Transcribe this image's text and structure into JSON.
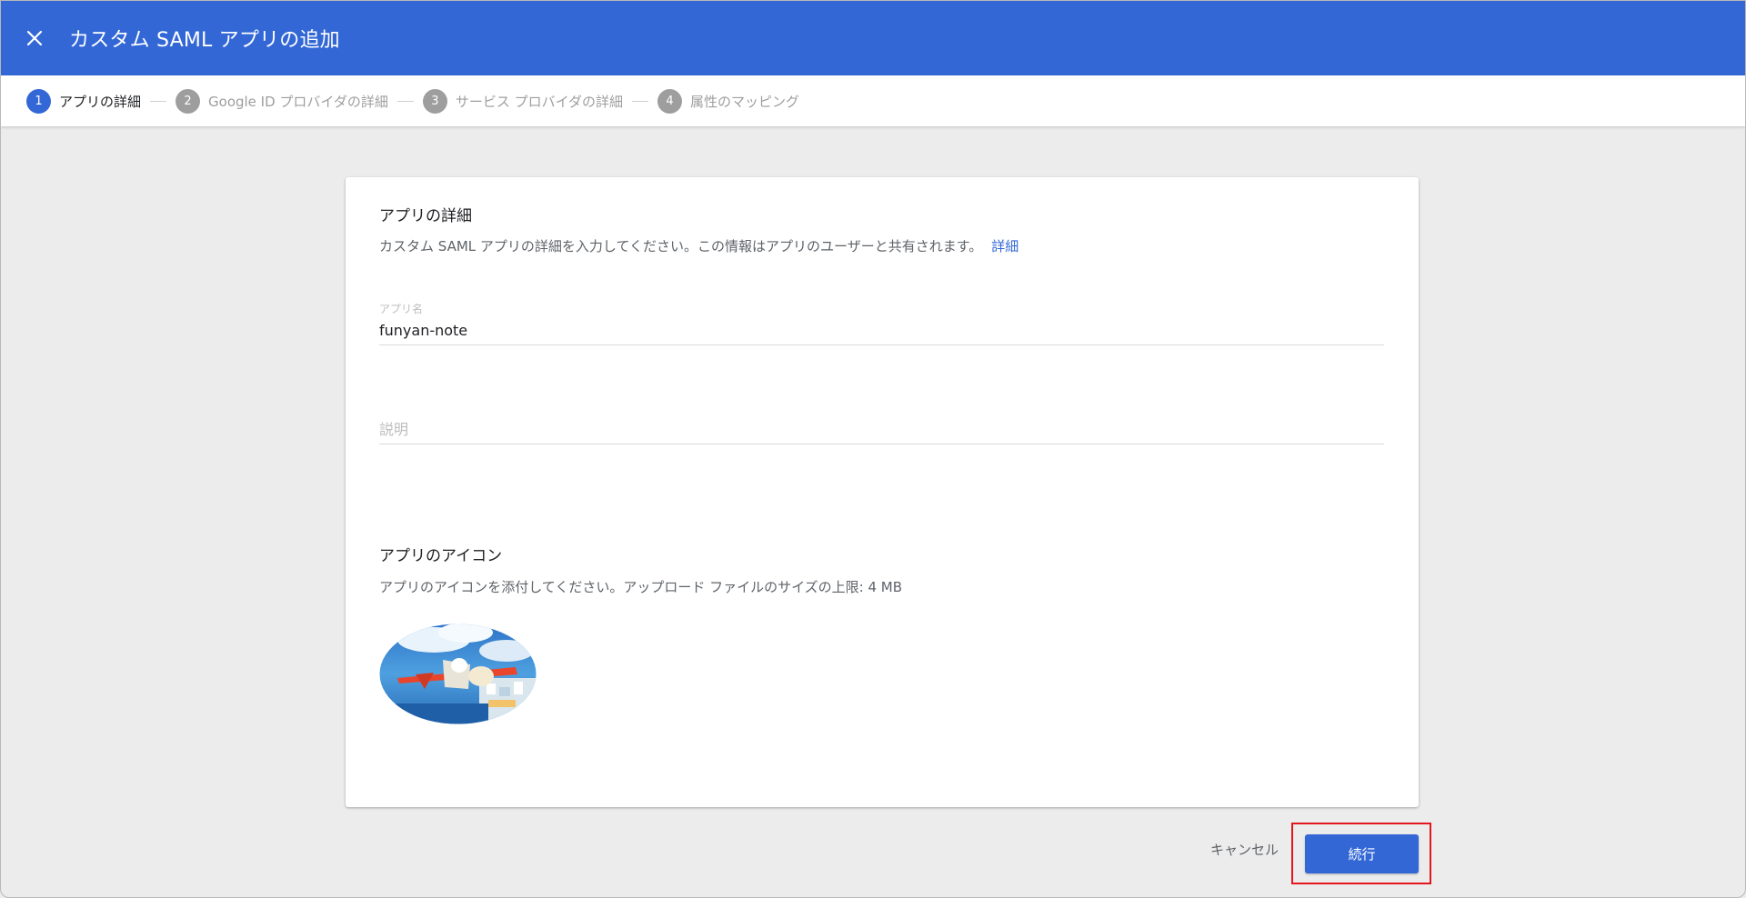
{
  "header": {
    "title": "カスタム SAML アプリの追加",
    "close_icon": "close-icon"
  },
  "stepper": {
    "steps": [
      {
        "number": "1",
        "label": "アプリの詳細",
        "active": true
      },
      {
        "number": "2",
        "label": "Google ID プロバイダの詳細",
        "active": false
      },
      {
        "number": "3",
        "label": "サービス プロバイダの詳細",
        "active": false
      },
      {
        "number": "4",
        "label": "属性のマッピング",
        "active": false
      }
    ]
  },
  "app_details": {
    "title": "アプリの詳細",
    "description": "カスタム SAML アプリの詳細を入力してください。この情報はアプリのユーザーと共有されます。",
    "link": "詳細",
    "app_name_label": "アプリ名",
    "app_name_value": "funyan-note",
    "description_placeholder": "説明"
  },
  "app_icon": {
    "title": "アプリのアイコン",
    "description": "アプリのアイコンを添付してください。アップロード ファイルのサイズの上限: 4 MB",
    "image": "app-icon-airplane-illustration"
  },
  "footer": {
    "cancel_label": "キャンセル",
    "continue_label": "続行"
  },
  "colors": {
    "primary": "#3367d6",
    "highlight": "#e2161f",
    "background": "#ececec"
  }
}
